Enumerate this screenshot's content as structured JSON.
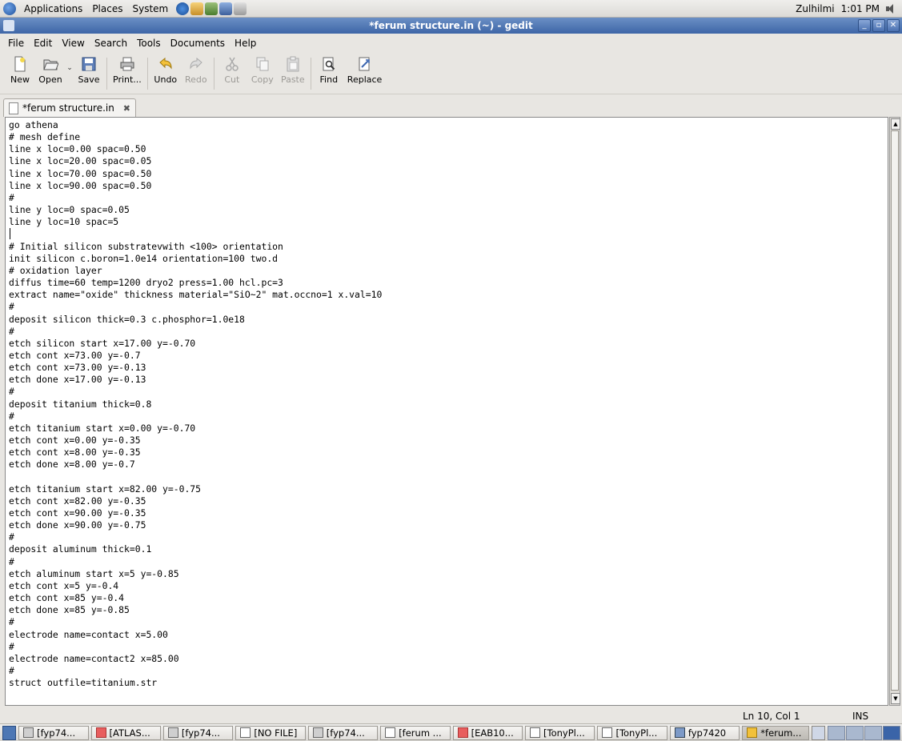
{
  "top_panel": {
    "menus": [
      "Applications",
      "Places",
      "System"
    ],
    "user": "Zulhilmi",
    "clock": "1:01 PM"
  },
  "window": {
    "title": "*ferum structure.in (~) - gedit"
  },
  "menubar": [
    "File",
    "Edit",
    "View",
    "Search",
    "Tools",
    "Documents",
    "Help"
  ],
  "toolbar": {
    "new": "New",
    "open": "Open",
    "save": "Save",
    "print": "Print...",
    "undo": "Undo",
    "redo": "Redo",
    "cut": "Cut",
    "copy": "Copy",
    "paste": "Paste",
    "find": "Find",
    "replace": "Replace"
  },
  "tab": {
    "label": "*ferum structure.in"
  },
  "editor": {
    "content": "go athena\n# mesh define\nline x loc=0.00 spac=0.50\nline x loc=20.00 spac=0.05\nline x loc=70.00 spac=0.50\nline x loc=90.00 spac=0.50\n#\nline y loc=0 spac=0.05\nline y loc=10 spac=5\n\n# Initial silicon substratevwith <100> orientation\ninit silicon c.boron=1.0e14 orientation=100 two.d\n# oxidation layer\ndiffus time=60 temp=1200 dryo2 press=1.00 hcl.pc=3\nextract name=\"oxide\" thickness material=\"SiO~2\" mat.occno=1 x.val=10\n#\ndeposit silicon thick=0.3 c.phosphor=1.0e18\n#\netch silicon start x=17.00 y=-0.70\netch cont x=73.00 y=-0.7\netch cont x=73.00 y=-0.13\netch done x=17.00 y=-0.13\n#\ndeposit titanium thick=0.8\n#\netch titanium start x=0.00 y=-0.70\netch cont x=0.00 y=-0.35\netch cont x=8.00 y=-0.35\netch done x=8.00 y=-0.7\n\netch titanium start x=82.00 y=-0.75\netch cont x=82.00 y=-0.35\netch cont x=90.00 y=-0.35\netch done x=90.00 y=-0.75\n#\ndeposit aluminum thick=0.1\n#\netch aluminum start x=5 y=-0.85\netch cont x=5 y=-0.4\netch cont x=85 y=-0.4\netch done x=85 y=-0.85\n#\nelectrode name=contact x=5.00\n#\nelectrode name=contact2 x=85.00\n#\nstruct outfile=titanium.str"
  },
  "statusbar": {
    "position": "Ln 10, Col 1",
    "mode": "INS"
  },
  "taskbar": [
    {
      "label": "[fyp74...",
      "icon": "terminal-icon"
    },
    {
      "label": "[ATLAS...",
      "icon": "tool-icon"
    },
    {
      "label": "[fyp74...",
      "icon": "terminal-icon"
    },
    {
      "label": "[NO FILE]",
      "icon": "window-icon"
    },
    {
      "label": "[fyp74...",
      "icon": "terminal-icon"
    },
    {
      "label": "[ferum ...",
      "icon": "window-icon"
    },
    {
      "label": "[EAB10...",
      "icon": "tool-icon"
    },
    {
      "label": "[TonyPl...",
      "icon": "window-icon"
    },
    {
      "label": "[TonyPl...",
      "icon": "window-icon"
    },
    {
      "label": "fyp7420",
      "icon": "folder-icon"
    },
    {
      "label": "*ferum...",
      "icon": "gedit-icon"
    }
  ]
}
